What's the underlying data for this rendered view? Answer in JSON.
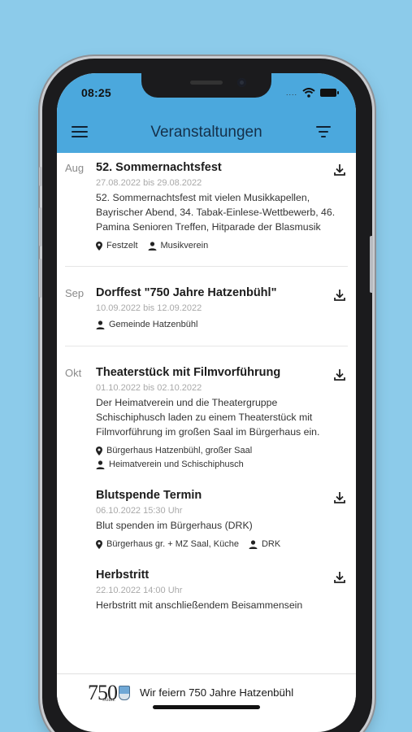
{
  "status_bar": {
    "time": "08:25",
    "signal": "...."
  },
  "app_bar": {
    "title": "Veranstaltungen"
  },
  "months": [
    {
      "label": "Aug",
      "events": [
        {
          "title": "52. Sommernachtsfest",
          "date": "27.08.2022 bis 29.08.2022",
          "description": "52. Sommernachtsfest mit vielen Musikkapellen, Bayrischer Abend, 34. Tabak-Einlese-Wettbewerb, 46. Pamina Senioren Treffen, Hitparade der Blasmusik",
          "location": "Festzelt",
          "organizer": "Musikverein"
        }
      ]
    },
    {
      "label": "Sep",
      "events": [
        {
          "title": "Dorffest \"750 Jahre Hatzenbühl\"",
          "date": "10.09.2022 bis 12.09.2022",
          "organizer": "Gemeinde Hatzenbühl"
        }
      ]
    },
    {
      "label": "Okt",
      "events": [
        {
          "title": "Theaterstück mit Filmvorführung",
          "date": "01.10.2022 bis 02.10.2022",
          "description": "Der Heimatverein und die Theatergruppe Schischiphusch laden zu einem Theaterstück mit Filmvorführung im großen Saal im Bürgerhaus ein.",
          "location": "Bürgerhaus Hatzenbühl, großer Saal",
          "organizer": "Heimatverein und Schischiphusch"
        },
        {
          "title": "Blutspende Termin",
          "date": "06.10.2022 15:30 Uhr",
          "description": "Blut spenden im Bürgerhaus (DRK)",
          "location": "Bürgerhaus gr. + MZ Saal, Küche",
          "organizer": "DRK"
        },
        {
          "title": "Herbstritt",
          "date": "22.10.2022 14:00 Uhr",
          "description": "Herbstritt mit anschließendem Beisammensein"
        }
      ]
    }
  ],
  "banner": {
    "logo_number": "750",
    "logo_sub": "JAHRE",
    "text": "Wir feiern 750 Jahre Hatzenbühl"
  },
  "colors": {
    "background": "#8ccbea",
    "app_bar": "#4ba8dd",
    "title": "#15304a"
  },
  "icons": {
    "menu": "menu-icon",
    "filter": "filter-icon",
    "download": "download-icon",
    "location": "location-pin-icon",
    "organizer": "person-icon"
  }
}
